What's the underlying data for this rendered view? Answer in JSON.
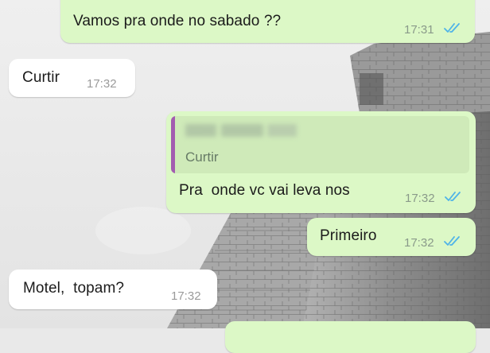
{
  "messages": [
    {
      "direction": "outgoing",
      "text": "Vamos pra onde no sabado ??",
      "time": "17:31",
      "status": "read"
    },
    {
      "direction": "incoming",
      "text": "Curtir",
      "time": "17:32"
    },
    {
      "direction": "outgoing",
      "quote": {
        "author": "",
        "text": "Curtir"
      },
      "text": "Pra  onde vc vai leva nos",
      "time": "17:32",
      "status": "read"
    },
    {
      "direction": "outgoing",
      "text": "Primeiro",
      "time": "17:32",
      "status": "read"
    },
    {
      "direction": "incoming",
      "text": "Motel,  topam?",
      "time": "17:32"
    }
  ],
  "colors": {
    "outgoing_bubble": "#dcf8c6",
    "incoming_bubble": "#ffffff",
    "read_ticks": "#4fb3e8",
    "quote_bar": "#a35cb0"
  },
  "icons": {
    "read_status": "double-check-icon"
  }
}
